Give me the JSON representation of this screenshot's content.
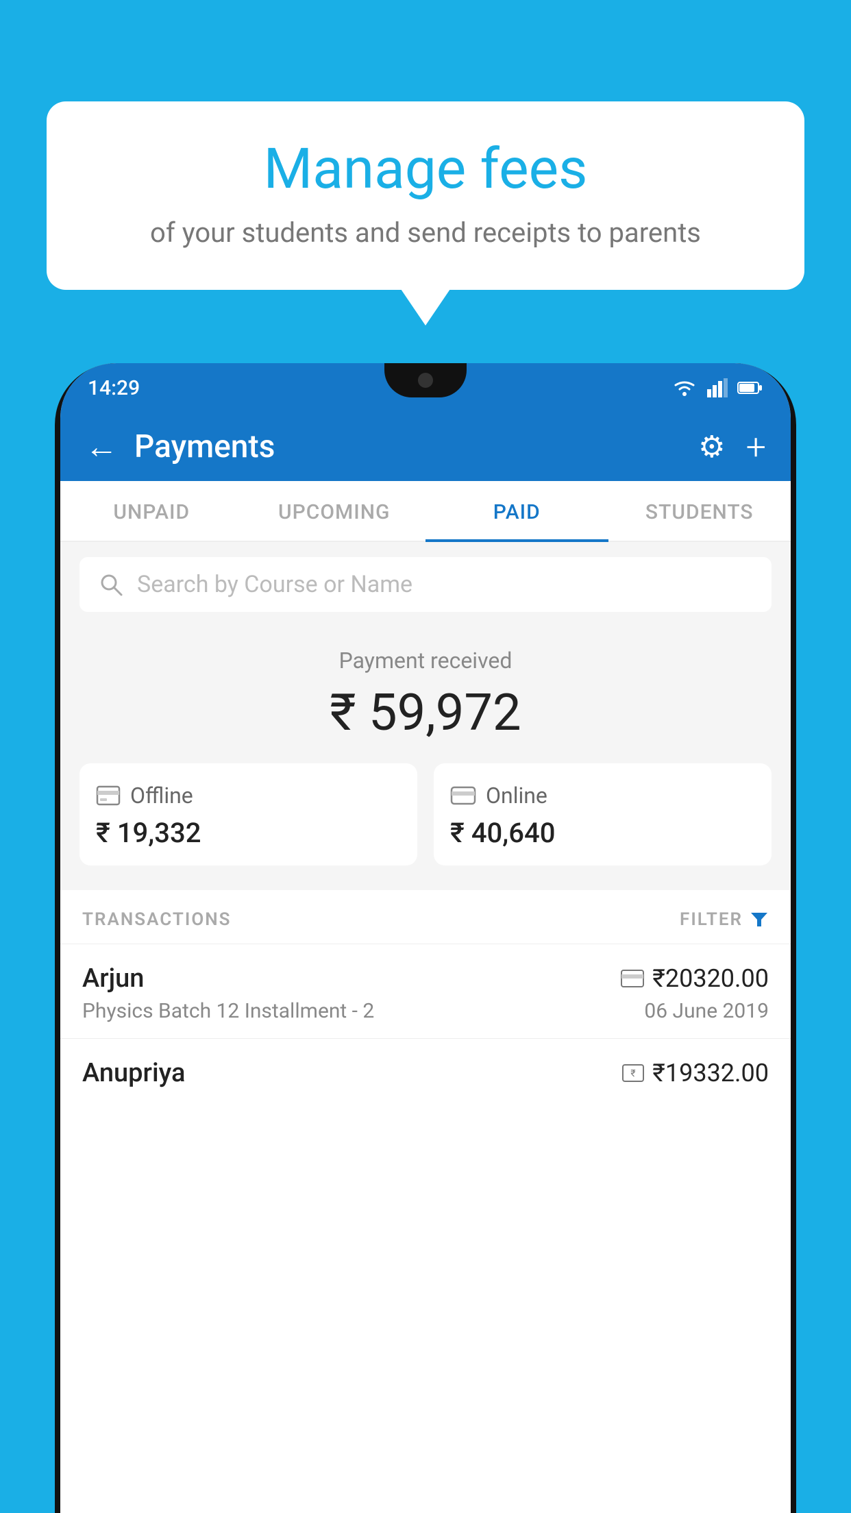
{
  "background_color": "#1AAFE6",
  "speech_bubble": {
    "title": "Manage fees",
    "subtitle": "of your students and send receipts to parents"
  },
  "status_bar": {
    "time": "14:29"
  },
  "header": {
    "title": "Payments",
    "back_label": "←",
    "settings_label": "⚙",
    "add_label": "+"
  },
  "tabs": [
    {
      "label": "UNPAID",
      "active": false
    },
    {
      "label": "UPCOMING",
      "active": false
    },
    {
      "label": "PAID",
      "active": true
    },
    {
      "label": "STUDENTS",
      "active": false
    }
  ],
  "search": {
    "placeholder": "Search by Course or Name"
  },
  "payment_summary": {
    "label": "Payment received",
    "amount": "₹ 59,972",
    "offline": {
      "label": "Offline",
      "amount": "₹ 19,332"
    },
    "online": {
      "label": "Online",
      "amount": "₹ 40,640"
    }
  },
  "transactions_section": {
    "label": "TRANSACTIONS",
    "filter_label": "FILTER"
  },
  "transactions": [
    {
      "name": "Arjun",
      "amount": "₹20320.00",
      "course": "Physics Batch 12 Installment - 2",
      "date": "06 June 2019",
      "payment_type": "online"
    },
    {
      "name": "Anupriya",
      "amount": "₹19332.00",
      "course": "",
      "date": "",
      "payment_type": "offline"
    }
  ]
}
